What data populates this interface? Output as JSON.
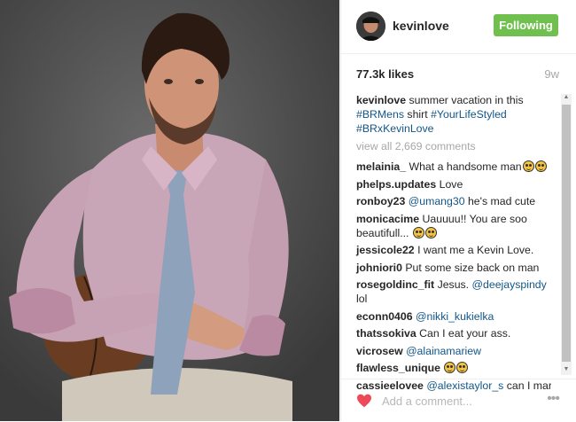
{
  "post": {
    "username": "kevinlove",
    "follow_label": "Following",
    "likes": "77.3k likes",
    "age": "9w",
    "caption": {
      "user": "kevinlove",
      "text": "summer vacation in this",
      "tags": [
        "#BRMens",
        "#YourLifeStyled",
        "#BRxKevinLove"
      ],
      "middle_word": "shirt"
    },
    "view_all": "view all 2,669 comments"
  },
  "comments": [
    {
      "user": "melainia_",
      "text": "What a handsome man",
      "emojis": 2
    },
    {
      "user": "phelps.updates",
      "text": "Love",
      "emojis": 0
    },
    {
      "user": "ronboy23",
      "mention": "@umang30",
      "text": "he's mad cute",
      "emojis": 0
    },
    {
      "user": "monicacime",
      "text": "Uauuuu!! You are soo beautifull...",
      "emojis": 2
    },
    {
      "user": "jessicole22",
      "text": "I want me a Kevin Love.",
      "emojis": 0
    },
    {
      "user": "johniori0",
      "text": "Put some size back on man",
      "emojis": 0
    },
    {
      "user": "rosegoldinc_fit",
      "text": "Jesus.",
      "mention_after": "@deejayspindy",
      "text_after": "lol",
      "emojis": 0
    },
    {
      "user": "econn0406",
      "mention": "@nikki_kukielka",
      "text": "",
      "emojis": 0
    },
    {
      "user": "thatssokiva",
      "text": "Can I eat your ass.",
      "emojis": 0
    },
    {
      "user": "vicrosew",
      "mention": "@alainamariew",
      "text": "",
      "emojis": 0
    },
    {
      "user": "flawless_unique",
      "text": "",
      "emojis": 2
    },
    {
      "user": "cassieelovee",
      "mention": "@alexistaylor_s",
      "text": "can I marry",
      "emojis": 0
    }
  ],
  "footer": {
    "placeholder": "Add a comment...",
    "more_label": "•••"
  },
  "colors": {
    "follow_green": "#70c050",
    "link_blue": "#125688",
    "muted_gray": "#a5a7aa",
    "heart_red": "#ed4956"
  },
  "icons": [
    "avatar",
    "heart-icon",
    "more-options-icon",
    "scroll-up-icon",
    "scroll-down-icon"
  ]
}
